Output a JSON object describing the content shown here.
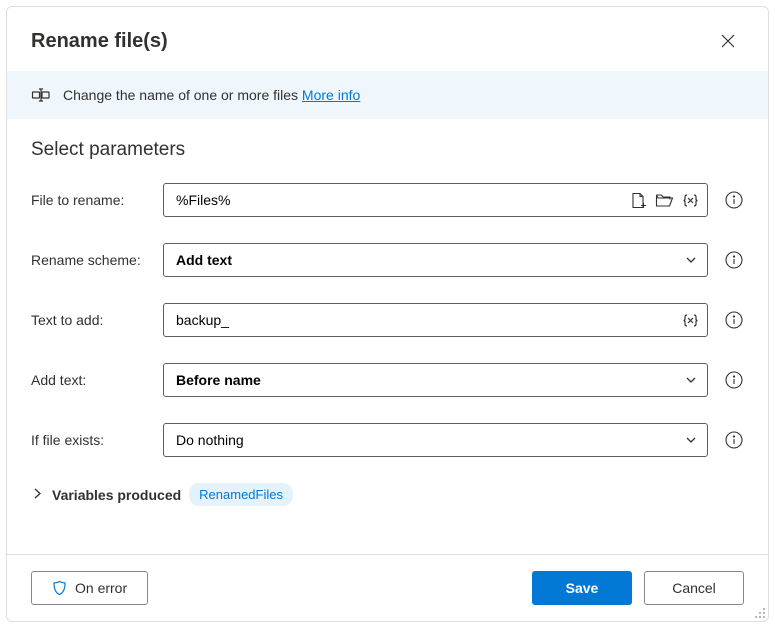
{
  "header": {
    "title": "Rename file(s)"
  },
  "info": {
    "text": "Change the name of one or more files ",
    "link": "More info"
  },
  "section_title": "Select parameters",
  "fields": {
    "file_to_rename": {
      "label": "File to rename:",
      "value": "%Files%"
    },
    "rename_scheme": {
      "label": "Rename scheme:",
      "value": "Add text"
    },
    "text_to_add": {
      "label": "Text to add:",
      "value": "backup_"
    },
    "add_text": {
      "label": "Add text:",
      "value": "Before name"
    },
    "if_file_exists": {
      "label": "If file exists:",
      "value": "Do nothing"
    }
  },
  "variables": {
    "label": "Variables produced",
    "chip": "RenamedFiles"
  },
  "footer": {
    "on_error": "On error",
    "save": "Save",
    "cancel": "Cancel"
  }
}
